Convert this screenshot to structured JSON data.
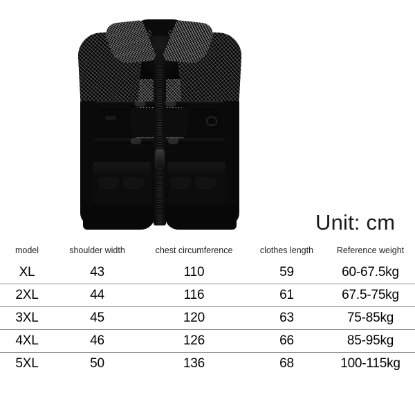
{
  "product_photo": {
    "alt": "black mesh multi-pocket fishing vest, front view",
    "parts": [
      "collar",
      "mesh-panel",
      "center-zipper",
      "chest-zip-pocket-left",
      "chest-zip-pocket-right",
      "flap-pocket-upper-left",
      "flap-pocket-upper-right",
      "cargo-pocket-lower-left",
      "cargo-pocket-lower-right",
      "d-ring",
      "hem"
    ]
  },
  "unit": {
    "label": "Unit: cm"
  },
  "size_table": {
    "headers": [
      "model",
      "shoulder width",
      "chest circumference",
      "clothes length",
      "Reference weight"
    ],
    "rows": [
      {
        "model": "XL",
        "shoulder_width": "43",
        "chest_circumference": "110",
        "clothes_length": "59",
        "reference_weight": "60-67.5kg"
      },
      {
        "model": "2XL",
        "shoulder_width": "44",
        "chest_circumference": "116",
        "clothes_length": "61",
        "reference_weight": "67.5-75kg"
      },
      {
        "model": "3XL",
        "shoulder_width": "45",
        "chest_circumference": "120",
        "clothes_length": "63",
        "reference_weight": "75-85kg"
      },
      {
        "model": "4XL",
        "shoulder_width": "46",
        "chest_circumference": "126",
        "clothes_length": "66",
        "reference_weight": "85-95kg"
      },
      {
        "model": "5XL",
        "shoulder_width": "50",
        "chest_circumference": "136",
        "clothes_length": "68",
        "reference_weight": "100-115kg"
      }
    ]
  },
  "colors": {
    "background": "#ffffff",
    "text": "#000000",
    "rule": "#8a8a8a",
    "garment": "#0a0a0a"
  }
}
